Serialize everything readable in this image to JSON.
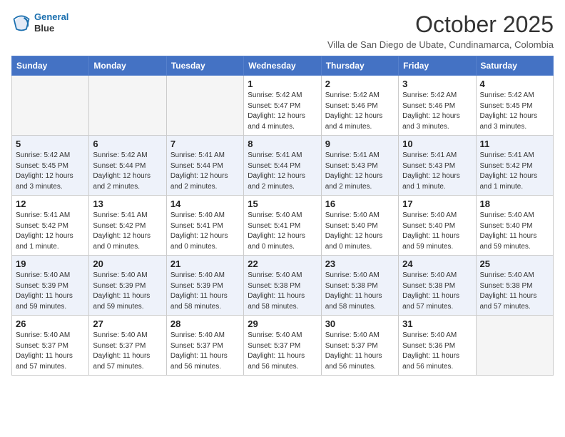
{
  "header": {
    "logo_line1": "General",
    "logo_line2": "Blue",
    "month": "October 2025",
    "subtitle": "Villa de San Diego de Ubate, Cundinamarca, Colombia"
  },
  "days_of_week": [
    "Sunday",
    "Monday",
    "Tuesday",
    "Wednesday",
    "Thursday",
    "Friday",
    "Saturday"
  ],
  "weeks": [
    [
      {
        "day": "",
        "info": ""
      },
      {
        "day": "",
        "info": ""
      },
      {
        "day": "",
        "info": ""
      },
      {
        "day": "1",
        "info": "Sunrise: 5:42 AM\nSunset: 5:47 PM\nDaylight: 12 hours\nand 4 minutes."
      },
      {
        "day": "2",
        "info": "Sunrise: 5:42 AM\nSunset: 5:46 PM\nDaylight: 12 hours\nand 4 minutes."
      },
      {
        "day": "3",
        "info": "Sunrise: 5:42 AM\nSunset: 5:46 PM\nDaylight: 12 hours\nand 3 minutes."
      },
      {
        "day": "4",
        "info": "Sunrise: 5:42 AM\nSunset: 5:45 PM\nDaylight: 12 hours\nand 3 minutes."
      }
    ],
    [
      {
        "day": "5",
        "info": "Sunrise: 5:42 AM\nSunset: 5:45 PM\nDaylight: 12 hours\nand 3 minutes."
      },
      {
        "day": "6",
        "info": "Sunrise: 5:42 AM\nSunset: 5:44 PM\nDaylight: 12 hours\nand 2 minutes."
      },
      {
        "day": "7",
        "info": "Sunrise: 5:41 AM\nSunset: 5:44 PM\nDaylight: 12 hours\nand 2 minutes."
      },
      {
        "day": "8",
        "info": "Sunrise: 5:41 AM\nSunset: 5:44 PM\nDaylight: 12 hours\nand 2 minutes."
      },
      {
        "day": "9",
        "info": "Sunrise: 5:41 AM\nSunset: 5:43 PM\nDaylight: 12 hours\nand 2 minutes."
      },
      {
        "day": "10",
        "info": "Sunrise: 5:41 AM\nSunset: 5:43 PM\nDaylight: 12 hours\nand 1 minute."
      },
      {
        "day": "11",
        "info": "Sunrise: 5:41 AM\nSunset: 5:42 PM\nDaylight: 12 hours\nand 1 minute."
      }
    ],
    [
      {
        "day": "12",
        "info": "Sunrise: 5:41 AM\nSunset: 5:42 PM\nDaylight: 12 hours\nand 1 minute."
      },
      {
        "day": "13",
        "info": "Sunrise: 5:41 AM\nSunset: 5:42 PM\nDaylight: 12 hours\nand 0 minutes."
      },
      {
        "day": "14",
        "info": "Sunrise: 5:40 AM\nSunset: 5:41 PM\nDaylight: 12 hours\nand 0 minutes."
      },
      {
        "day": "15",
        "info": "Sunrise: 5:40 AM\nSunset: 5:41 PM\nDaylight: 12 hours\nand 0 minutes."
      },
      {
        "day": "16",
        "info": "Sunrise: 5:40 AM\nSunset: 5:40 PM\nDaylight: 12 hours\nand 0 minutes."
      },
      {
        "day": "17",
        "info": "Sunrise: 5:40 AM\nSunset: 5:40 PM\nDaylight: 11 hours\nand 59 minutes."
      },
      {
        "day": "18",
        "info": "Sunrise: 5:40 AM\nSunset: 5:40 PM\nDaylight: 11 hours\nand 59 minutes."
      }
    ],
    [
      {
        "day": "19",
        "info": "Sunrise: 5:40 AM\nSunset: 5:39 PM\nDaylight: 11 hours\nand 59 minutes."
      },
      {
        "day": "20",
        "info": "Sunrise: 5:40 AM\nSunset: 5:39 PM\nDaylight: 11 hours\nand 59 minutes."
      },
      {
        "day": "21",
        "info": "Sunrise: 5:40 AM\nSunset: 5:39 PM\nDaylight: 11 hours\nand 58 minutes."
      },
      {
        "day": "22",
        "info": "Sunrise: 5:40 AM\nSunset: 5:38 PM\nDaylight: 11 hours\nand 58 minutes."
      },
      {
        "day": "23",
        "info": "Sunrise: 5:40 AM\nSunset: 5:38 PM\nDaylight: 11 hours\nand 58 minutes."
      },
      {
        "day": "24",
        "info": "Sunrise: 5:40 AM\nSunset: 5:38 PM\nDaylight: 11 hours\nand 57 minutes."
      },
      {
        "day": "25",
        "info": "Sunrise: 5:40 AM\nSunset: 5:38 PM\nDaylight: 11 hours\nand 57 minutes."
      }
    ],
    [
      {
        "day": "26",
        "info": "Sunrise: 5:40 AM\nSunset: 5:37 PM\nDaylight: 11 hours\nand 57 minutes."
      },
      {
        "day": "27",
        "info": "Sunrise: 5:40 AM\nSunset: 5:37 PM\nDaylight: 11 hours\nand 57 minutes."
      },
      {
        "day": "28",
        "info": "Sunrise: 5:40 AM\nSunset: 5:37 PM\nDaylight: 11 hours\nand 56 minutes."
      },
      {
        "day": "29",
        "info": "Sunrise: 5:40 AM\nSunset: 5:37 PM\nDaylight: 11 hours\nand 56 minutes."
      },
      {
        "day": "30",
        "info": "Sunrise: 5:40 AM\nSunset: 5:37 PM\nDaylight: 11 hours\nand 56 minutes."
      },
      {
        "day": "31",
        "info": "Sunrise: 5:40 AM\nSunset: 5:36 PM\nDaylight: 11 hours\nand 56 minutes."
      },
      {
        "day": "",
        "info": ""
      }
    ]
  ]
}
